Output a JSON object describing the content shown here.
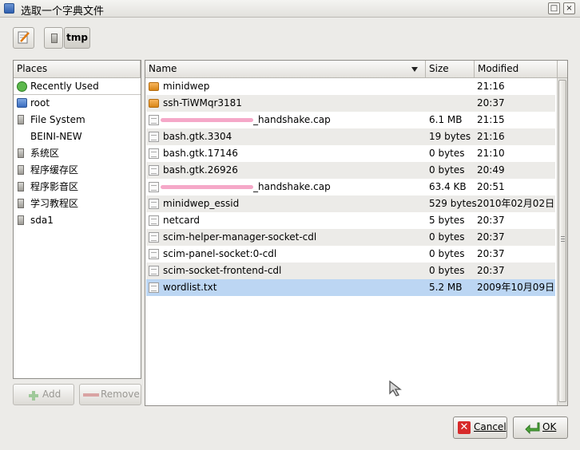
{
  "window": {
    "title": "选取一个字典文件",
    "controls": {
      "maximize": "□",
      "close": "×"
    }
  },
  "toolbar": {
    "path_button": "tmp"
  },
  "places": {
    "header": "Places",
    "items": [
      {
        "label": "Recently Used",
        "icon": "recent-icon"
      },
      {
        "label": "root",
        "icon": "home-icon"
      },
      {
        "label": "File System",
        "icon": "drive-icon"
      },
      {
        "label": "BEINI-NEW",
        "icon": "none"
      },
      {
        "label": "系统区",
        "icon": "drive-icon"
      },
      {
        "label": "程序缓存区",
        "icon": "drive-icon"
      },
      {
        "label": "程序影音区",
        "icon": "drive-icon"
      },
      {
        "label": "学习教程区",
        "icon": "drive-icon"
      },
      {
        "label": "sda1",
        "icon": "drive-icon"
      }
    ],
    "add_label": "Add",
    "remove_label": "Remove"
  },
  "files": {
    "columns": {
      "name": "Name",
      "size": "Size",
      "modified": "Modified"
    },
    "rows": [
      {
        "name": "minidwep",
        "size": "",
        "modified": "21:16",
        "type": "folder"
      },
      {
        "name": "ssh-TiWMqr3181",
        "size": "",
        "modified": "20:37",
        "type": "folder"
      },
      {
        "name": "_handshake.cap",
        "size": "6.1 MB",
        "modified": "21:15",
        "type": "file",
        "redacted": true
      },
      {
        "name": "bash.gtk.3304",
        "size": "19 bytes",
        "modified": "21:16",
        "type": "file"
      },
      {
        "name": "bash.gtk.17146",
        "size": "0 bytes",
        "modified": "21:10",
        "type": "file"
      },
      {
        "name": "bash.gtk.26926",
        "size": "0 bytes",
        "modified": "20:49",
        "type": "file"
      },
      {
        "name": "_handshake.cap",
        "size": "63.4 KB",
        "modified": "20:51",
        "type": "file",
        "redacted": true
      },
      {
        "name": "minidwep_essid",
        "size": "529 bytes",
        "modified": "2010年02月02日",
        "type": "file"
      },
      {
        "name": "netcard",
        "size": "5 bytes",
        "modified": "20:37",
        "type": "file"
      },
      {
        "name": "scim-helper-manager-socket-cdl",
        "size": "0 bytes",
        "modified": "20:37",
        "type": "file"
      },
      {
        "name": "scim-panel-socket:0-cdl",
        "size": "0 bytes",
        "modified": "20:37",
        "type": "file"
      },
      {
        "name": "scim-socket-frontend-cdl",
        "size": "0 bytes",
        "modified": "20:37",
        "type": "file"
      },
      {
        "name": "wordlist.txt",
        "size": "5.2 MB",
        "modified": "2009年10月09日",
        "type": "file",
        "selected": true
      }
    ]
  },
  "dialog": {
    "cancel_label": "Cancel",
    "ok_label": "OK"
  },
  "colors": {
    "selection": "#bcd6f3",
    "window_bg": "#ecebe8"
  }
}
